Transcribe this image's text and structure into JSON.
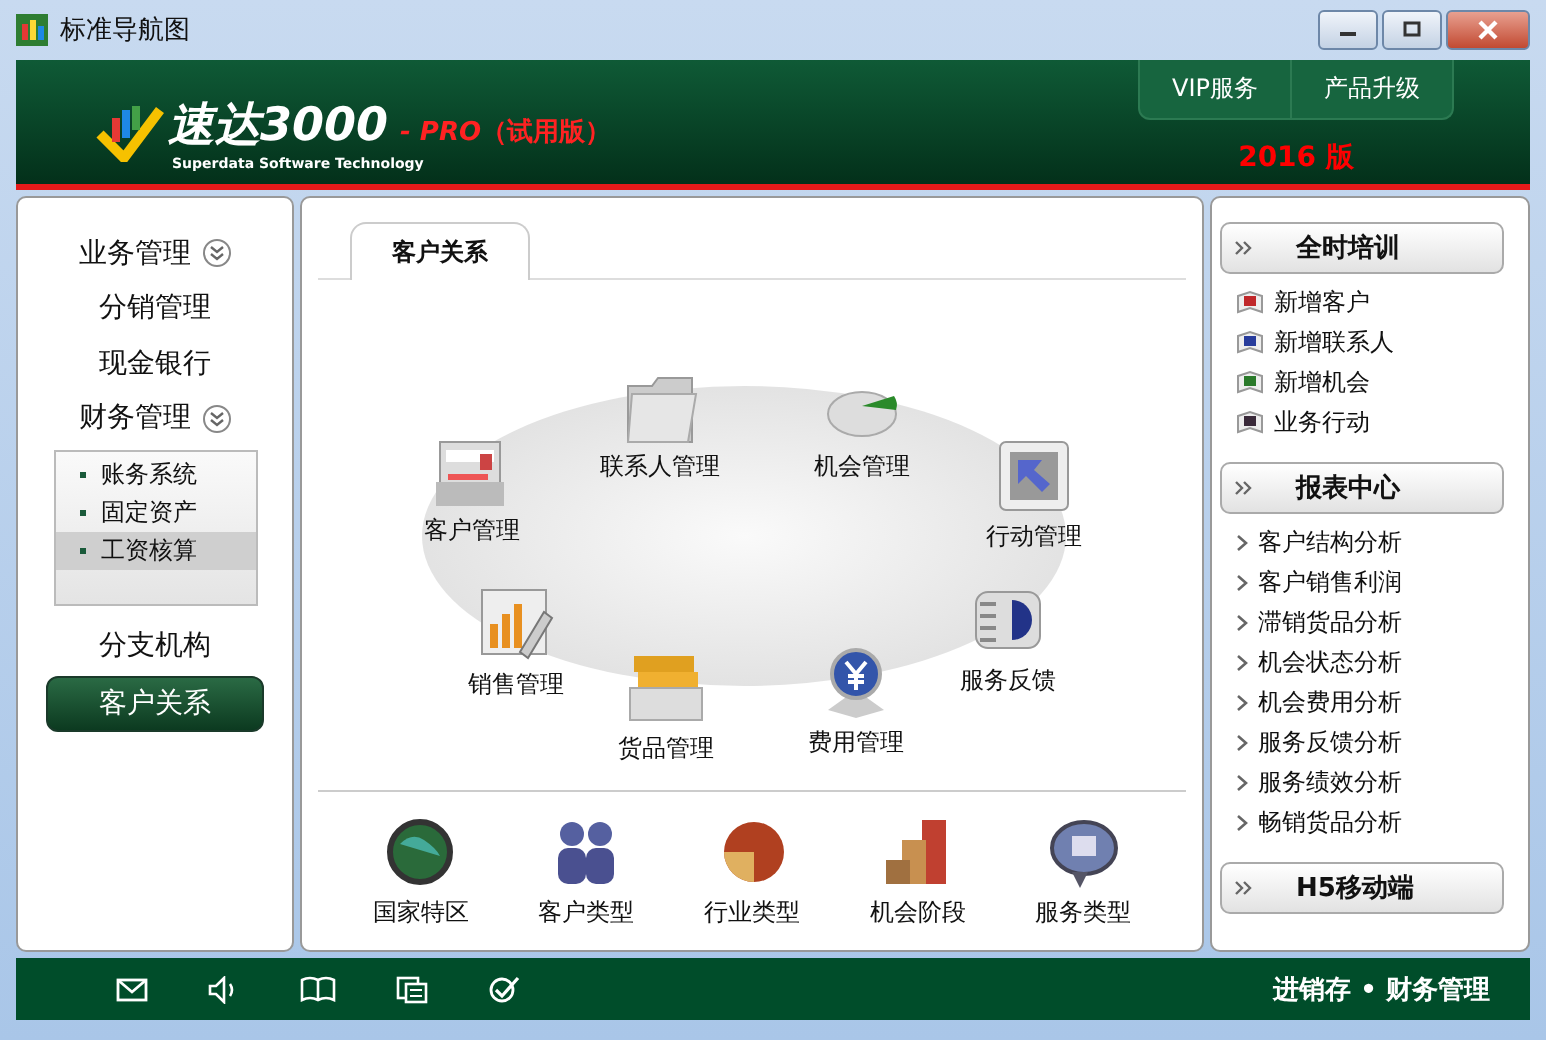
{
  "window": {
    "title": "标准导航图"
  },
  "header": {
    "logo_name": "速达3000",
    "logo_subtitle": "Superdata Software Technology",
    "edition": "- PRO",
    "trial": "（试用版）",
    "version": "2016 版",
    "tabs": [
      {
        "label": "VIP服务"
      },
      {
        "label": "产品升级"
      }
    ]
  },
  "sidebar": {
    "items": [
      {
        "label": "业务管理",
        "expanded": false,
        "selected": false
      },
      {
        "label": "分销管理",
        "selected": false
      },
      {
        "label": "现金银行",
        "selected": false
      },
      {
        "label": "财务管理",
        "expanded": true,
        "selected": false,
        "children": [
          {
            "label": "账务系统",
            "selected": false
          },
          {
            "label": "固定资产",
            "selected": false
          },
          {
            "label": "工资核算",
            "selected": true
          }
        ]
      },
      {
        "label": "分支机构",
        "selected": false
      },
      {
        "label": "客户关系",
        "selected": true
      }
    ]
  },
  "main": {
    "tabs": [
      {
        "label": "客户关系",
        "selected": true
      }
    ],
    "hub_items": [
      {
        "label": "客户管理"
      },
      {
        "label": "联系人管理"
      },
      {
        "label": "机会管理"
      },
      {
        "label": "行动管理"
      },
      {
        "label": "销售管理"
      },
      {
        "label": "货品管理"
      },
      {
        "label": "费用管理"
      },
      {
        "label": "服务反馈"
      }
    ],
    "bottom_items": [
      {
        "label": "国家特区"
      },
      {
        "label": "客户类型"
      },
      {
        "label": "行业类型"
      },
      {
        "label": "机会阶段"
      },
      {
        "label": "服务类型"
      }
    ]
  },
  "right_panel": {
    "sections": [
      {
        "title": "全时培训",
        "kind": "icons",
        "items": [
          {
            "label": "新增客户",
            "color": "#c0282a"
          },
          {
            "label": "新增联系人",
            "color": "#283c9c"
          },
          {
            "label": "新增机会",
            "color": "#2a7a2a"
          },
          {
            "label": "业务行动",
            "color": "#3a2a3a"
          }
        ]
      },
      {
        "title": "报表中心",
        "kind": "arrows",
        "items": [
          {
            "label": "客户结构分析"
          },
          {
            "label": "客户销售利润"
          },
          {
            "label": "滞销货品分析"
          },
          {
            "label": "机会状态分析"
          },
          {
            "label": "机会费用分析"
          },
          {
            "label": "服务反馈分析"
          },
          {
            "label": "服务绩效分析"
          },
          {
            "label": "畅销货品分析"
          }
        ]
      },
      {
        "title": "H5移动端"
      }
    ]
  },
  "status_bar": {
    "text": "进销存 • 财务管理"
  }
}
